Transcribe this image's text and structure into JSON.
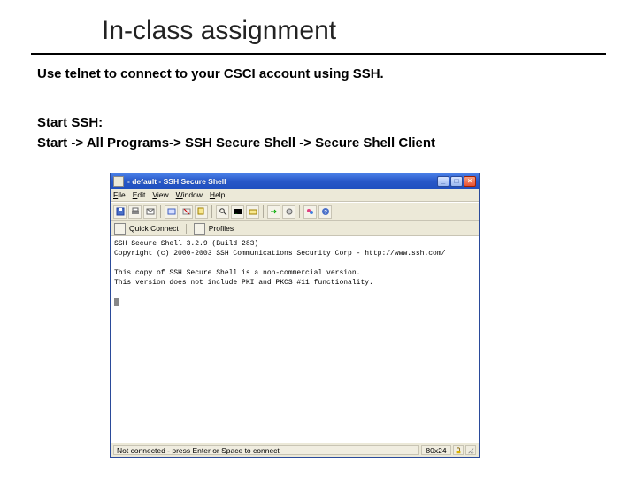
{
  "slide": {
    "title": "In-class assignment",
    "line1": "Use telnet to connect to your CSCI account using SSH.",
    "line2": "Start SSH:",
    "line3": "Start -> All Programs-> SSH Secure Shell -> Secure Shell Client"
  },
  "window": {
    "title": "- default - SSH Secure Shell",
    "buttons": {
      "min": "_",
      "max": "□",
      "close": "×"
    },
    "menu": {
      "file": "File",
      "edit": "Edit",
      "view": "View",
      "window": "Window",
      "help": "Help"
    },
    "quickbar": {
      "quick": "Quick Connect",
      "profiles": "Profiles"
    },
    "terminal": {
      "l1": "SSH Secure Shell 3.2.9 (Build 283)",
      "l2": "Copyright (c) 2000-2003 SSH Communications Security Corp - http://www.ssh.com/",
      "l3": "",
      "l4": "This copy of SSH Secure Shell is a non-commercial version.",
      "l5": "This version does not include PKI and PKCS #11 functionality.",
      "l6": ""
    },
    "status": {
      "main": "Not connected - press Enter or Space to connect",
      "pos": "80x24"
    }
  }
}
